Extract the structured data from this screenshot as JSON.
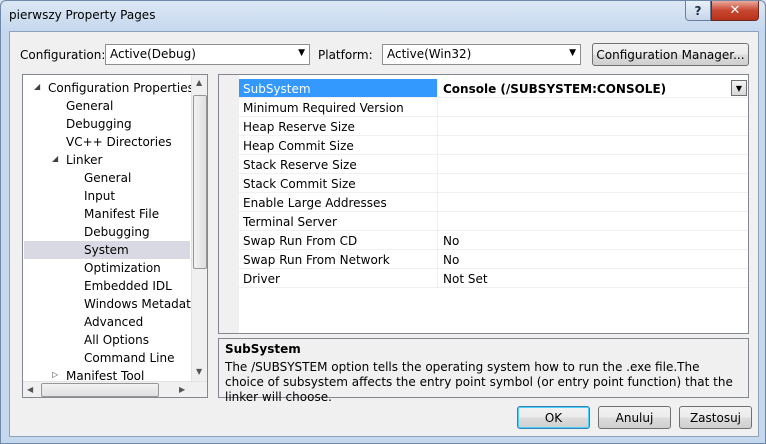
{
  "window": {
    "title": "pierwszy Property Pages",
    "help": "?",
    "close": "✕"
  },
  "toolbar": {
    "configuration_label": "Configuration:",
    "configuration_value": "Active(Debug)",
    "platform_label": "Platform:",
    "platform_value": "Active(Win32)",
    "config_manager_label": "Configuration Manager..."
  },
  "tree": {
    "items": [
      {
        "label": "Configuration Properties",
        "level": 0,
        "expanded": true
      },
      {
        "label": "General",
        "level": 1
      },
      {
        "label": "Debugging",
        "level": 1
      },
      {
        "label": "VC++ Directories",
        "level": 1
      },
      {
        "label": "Linker",
        "level": 1,
        "expanded": true
      },
      {
        "label": "General",
        "level": 2
      },
      {
        "label": "Input",
        "level": 2
      },
      {
        "label": "Manifest File",
        "level": 2
      },
      {
        "label": "Debugging",
        "level": 2
      },
      {
        "label": "System",
        "level": 2,
        "selected": true
      },
      {
        "label": "Optimization",
        "level": 2
      },
      {
        "label": "Embedded IDL",
        "level": 2
      },
      {
        "label": "Windows Metadata",
        "level": 2
      },
      {
        "label": "Advanced",
        "level": 2
      },
      {
        "label": "All Options",
        "level": 2
      },
      {
        "label": "Command Line",
        "level": 2
      },
      {
        "label": "Manifest Tool",
        "level": 1,
        "collapsed": true
      }
    ]
  },
  "grid": {
    "rows": [
      {
        "name": "SubSystem",
        "value": "Console (/SUBSYSTEM:CONSOLE)",
        "selected": true
      },
      {
        "name": "Minimum Required Version",
        "value": ""
      },
      {
        "name": "Heap Reserve Size",
        "value": ""
      },
      {
        "name": "Heap Commit Size",
        "value": ""
      },
      {
        "name": "Stack Reserve Size",
        "value": ""
      },
      {
        "name": "Stack Commit Size",
        "value": ""
      },
      {
        "name": "Enable Large Addresses",
        "value": ""
      },
      {
        "name": "Terminal Server",
        "value": ""
      },
      {
        "name": "Swap Run From CD",
        "value": "No"
      },
      {
        "name": "Swap Run From Network",
        "value": "No"
      },
      {
        "name": "Driver",
        "value": "Not Set"
      }
    ]
  },
  "description": {
    "title": "SubSystem",
    "text": "The /SUBSYSTEM option tells the operating system how to run the .exe file.The choice of subsystem affects the entry point symbol (or entry point function) that the linker will choose."
  },
  "buttons": {
    "ok": "OK",
    "cancel": "Anuluj",
    "apply": "Zastosuj"
  }
}
